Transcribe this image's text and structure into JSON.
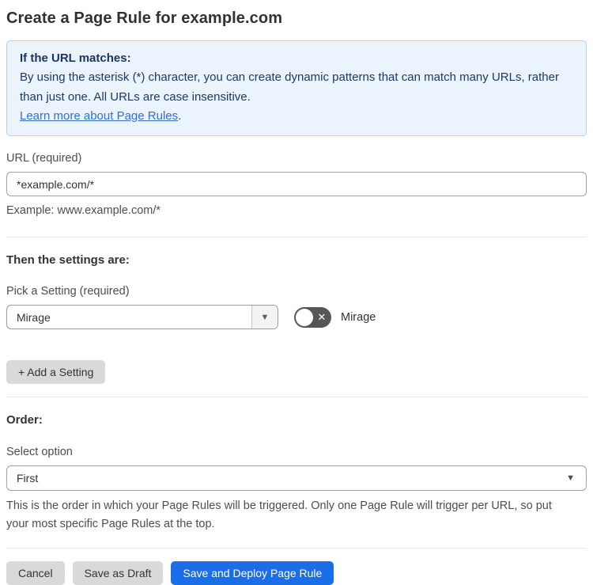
{
  "page": {
    "title": "Create a Page Rule for example.com"
  },
  "info_box": {
    "heading": "If the URL matches:",
    "body": "By using the asterisk (*) character, you can create dynamic patterns that can match many URLs, rather than just one. All URLs are case insensitive.",
    "link_label": "Learn more about Page Rules",
    "link_suffix": "."
  },
  "url_field": {
    "label": "URL (required)",
    "value": "*example.com/*",
    "helper": "Example: www.example.com/*"
  },
  "settings_section": {
    "heading": "Then the settings are:",
    "picker_label": "Pick a Setting (required)",
    "picker_value": "Mirage",
    "picker_arrow_icon": "▼",
    "toggle_label": "Mirage",
    "toggle_state": "off",
    "toggle_x_icon": "✕",
    "add_button_label": "+ Add a Setting"
  },
  "order_section": {
    "heading": "Order:",
    "select_label": "Select option",
    "select_value": "First",
    "select_arrow_icon": "▼",
    "helper": "This is the order in which your Page Rules will be triggered. Only one Page Rule will trigger per URL, so put your most specific Page Rules at the top."
  },
  "footer": {
    "cancel_label": "Cancel",
    "save_draft_label": "Save as Draft",
    "save_deploy_label": "Save and Deploy Page Rule"
  },
  "colors": {
    "info_bg": "#ebf3fc",
    "info_border": "#b3d1ef",
    "info_text": "#1b3a66",
    "link": "#3370cc",
    "primary_button": "#1a6ee8",
    "toggle_off": "#565656",
    "secondary_button": "#d9d9d9"
  }
}
